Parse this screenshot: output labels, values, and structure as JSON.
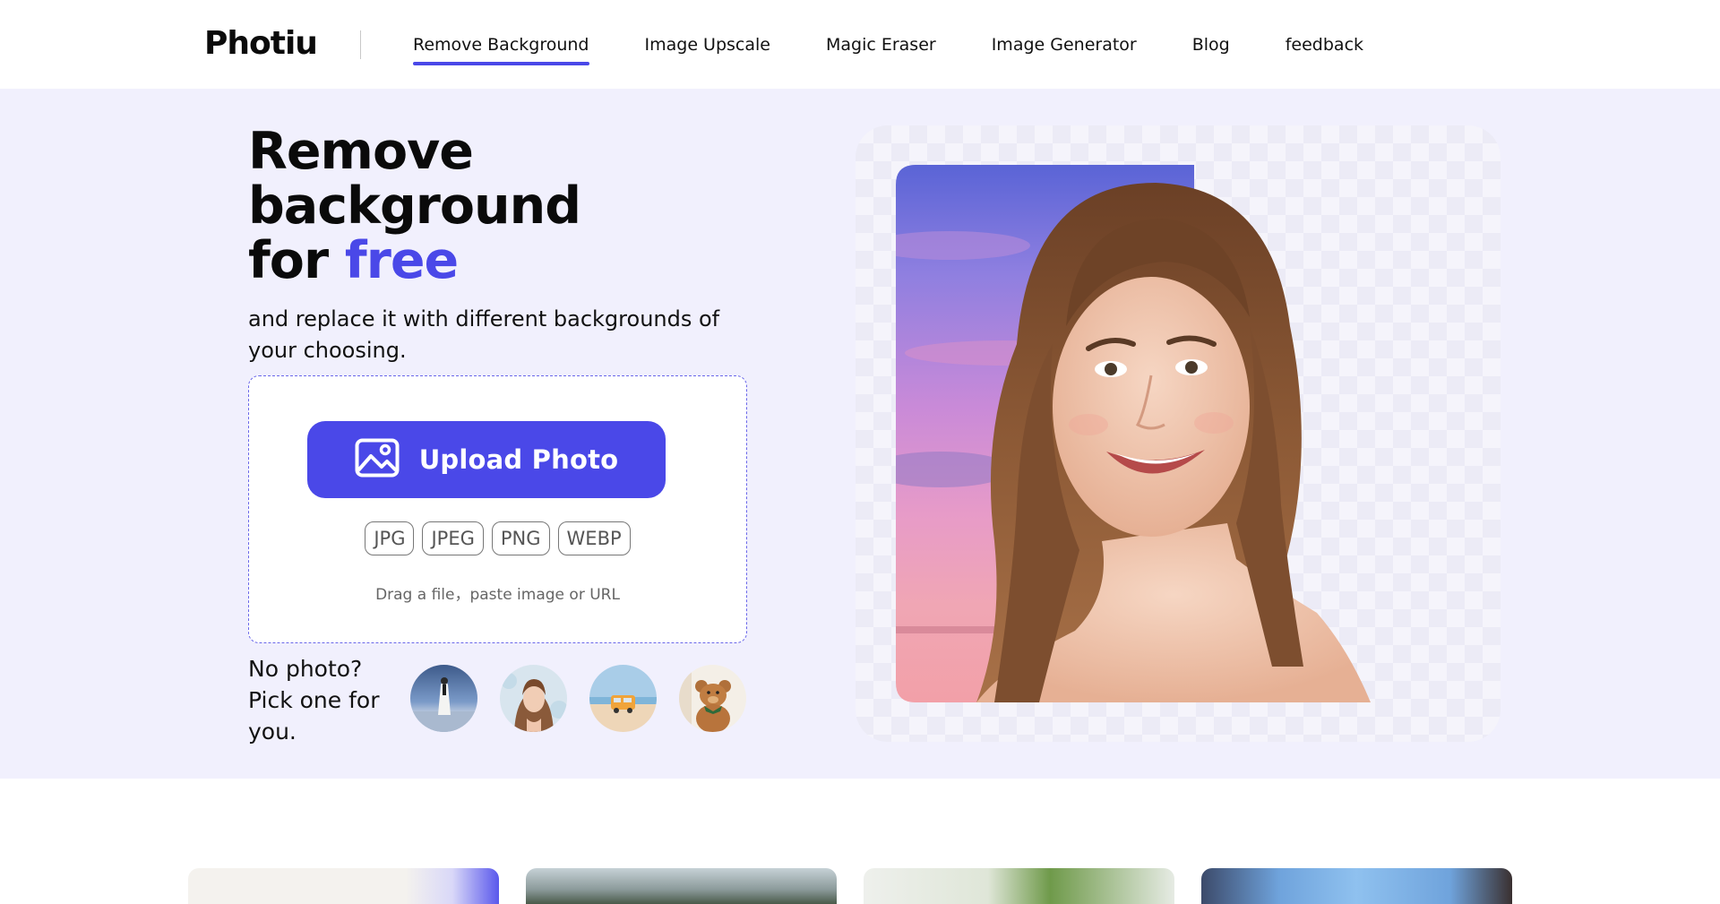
{
  "brand": {
    "name": "Photiu"
  },
  "nav": {
    "items": [
      {
        "label": "Remove Background",
        "active": true
      },
      {
        "label": "Image Upscale"
      },
      {
        "label": "Magic Eraser"
      },
      {
        "label": "Image Generator"
      },
      {
        "label": "Blog"
      },
      {
        "label": "feedback"
      }
    ]
  },
  "hero": {
    "title_line1": "Remove",
    "title_line2": "background",
    "title_line3_prefix": "for ",
    "title_accent": "free",
    "subtitle": "and replace it with different backgrounds of your choosing.",
    "upload_label": "Upload Photo",
    "formats": [
      "JPG",
      "JPEG",
      "PNG",
      "WEBP"
    ],
    "drag_hint": "Drag a file，paste image or URL",
    "sample_prompt": "No photo? Pick one for you."
  },
  "colors": {
    "accent": "#4a48e8",
    "hero_bg": "#f1f0fd"
  },
  "icons": {
    "upload": "image-icon"
  }
}
